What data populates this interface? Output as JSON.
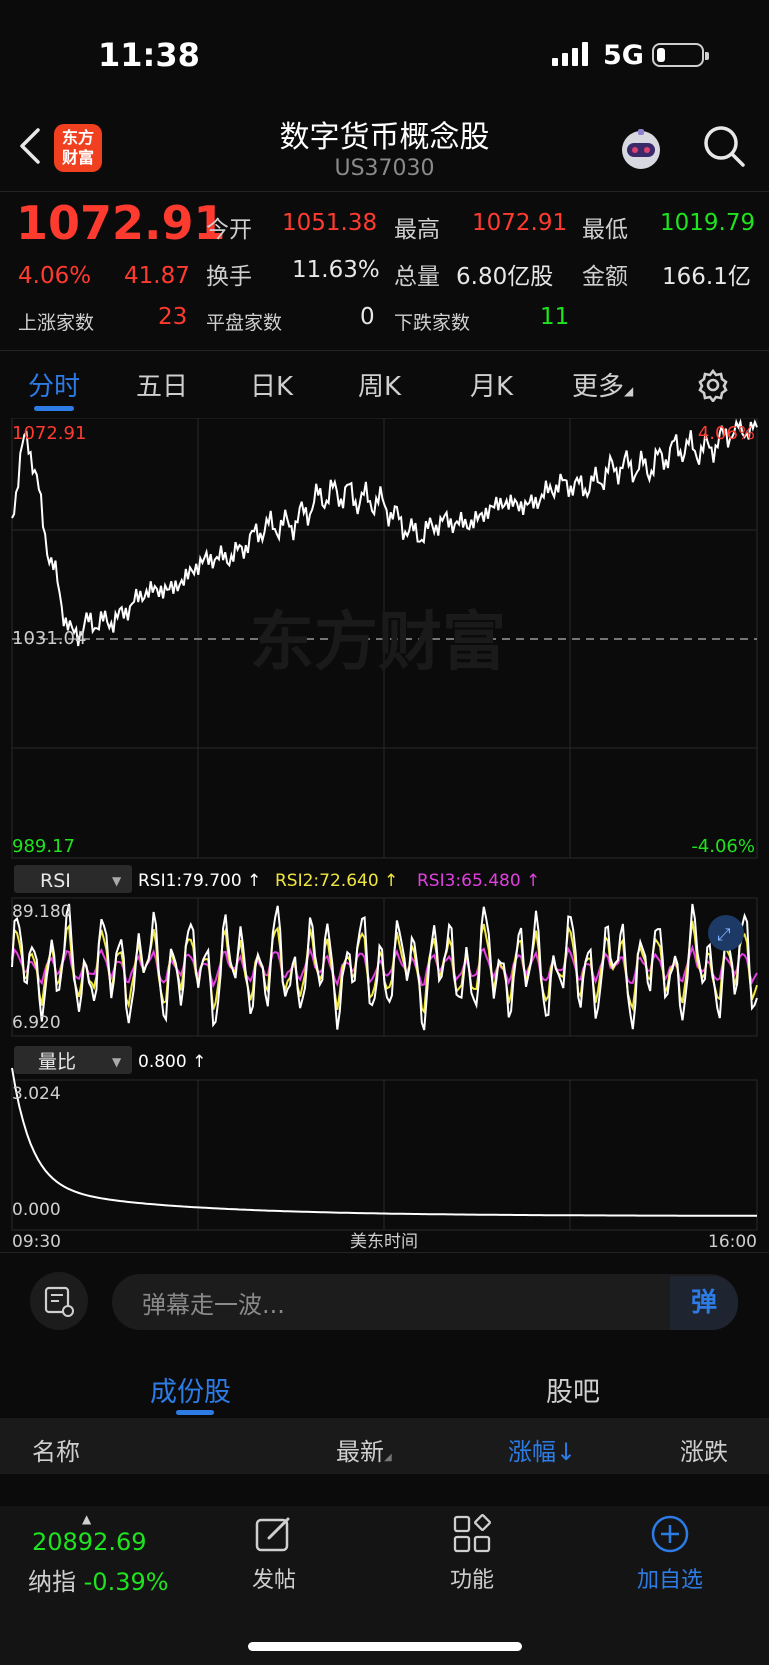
{
  "status": {
    "time": "11:38",
    "network": "5G"
  },
  "header": {
    "title": "数字货币概念股",
    "code": "US37030",
    "logo_line1": "东方",
    "logo_line2": "财富"
  },
  "quote": {
    "price": "1072.91",
    "change_pct": "4.06%",
    "change": "41.87",
    "open_label": "今开",
    "open": "1051.38",
    "high_label": "最高",
    "high": "1072.91",
    "low_label": "最低",
    "low": "1019.79",
    "turnover_label": "换手",
    "turnover": "11.63%",
    "volume_label": "总量",
    "volume": "6.80亿股",
    "amount_label": "金额",
    "amount": "166.1亿",
    "up_label": "上涨家数",
    "up": "23",
    "flat_label": "平盘家数",
    "flat": "0",
    "down_label": "下跌家数",
    "down": "11"
  },
  "tabs": [
    "分时",
    "五日",
    "日K",
    "周K",
    "月K",
    "更多"
  ],
  "chart": {
    "price_top": "1072.91",
    "pct_top": "4.06%",
    "price_mid": "1031.04",
    "price_bottom": "989.17",
    "pct_bottom": "-4.06%",
    "watermark": "东方财富",
    "rsi_selector": "RSI",
    "rsi1": "RSI1:79.700 ↑",
    "rsi2": "RSI2:72.640 ↑",
    "rsi3": "RSI3:65.480 ↑",
    "rsi_max": "89.180",
    "rsi_min": "6.920",
    "vr_selector": "量比",
    "vr_value": "0.800 ↑",
    "vr_max": "3.024",
    "vr_min": "0.000",
    "time_start": "09:30",
    "time_mid": "美东时间",
    "time_end": "16:00",
    "colors": {
      "rsi1": "#ffffff",
      "rsi2": "#f0e640",
      "rsi3": "#e040e0",
      "up": "#ff3b30",
      "down": "#1ee31e",
      "accent": "#2d7be5"
    }
  },
  "danmu": {
    "placeholder": "弹幕走一波...",
    "send": "弹"
  },
  "subtabs": [
    "成份股",
    "股吧"
  ],
  "table_header": {
    "name": "名称",
    "latest": "最新",
    "change_pct": "涨幅↓",
    "change": "涨跌"
  },
  "bottom": {
    "index_value": "20892.69",
    "index_name": "纳指",
    "index_pct": "-0.39%",
    "post": "发帖",
    "functions": "功能",
    "add_watch": "加自选"
  }
}
